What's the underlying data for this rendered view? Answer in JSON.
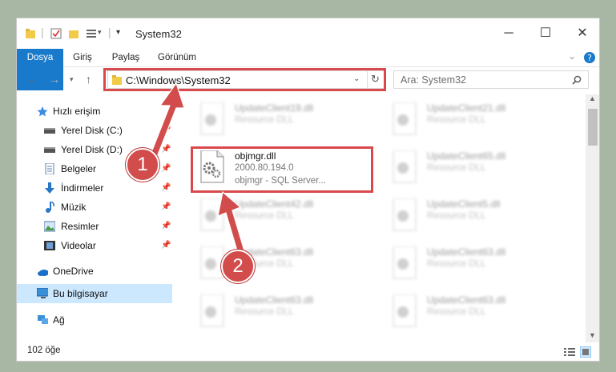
{
  "window": {
    "title": "System32",
    "controls": {
      "minimize": "─",
      "maximize": "☐",
      "close": "✕"
    }
  },
  "ribbon": {
    "tabs": [
      "Dosya",
      "Giriş",
      "Paylaş",
      "Görünüm"
    ],
    "accent": "#1979ca"
  },
  "address": {
    "path": "C:\\Windows\\System32",
    "search_placeholder": "Ara: System32"
  },
  "sidebar": {
    "items": [
      {
        "label": "Hızlı erişim",
        "icon": "star-icon",
        "pinned": false
      },
      {
        "label": "Yerel Disk (C:)",
        "icon": "drive-icon",
        "pinned": true
      },
      {
        "label": "Yerel Disk (D:)",
        "icon": "drive-icon",
        "pinned": true
      },
      {
        "label": "Belgeler",
        "icon": "documents-icon",
        "pinned": true
      },
      {
        "label": "İndirmeler",
        "icon": "download-icon",
        "pinned": true
      },
      {
        "label": "Müzik",
        "icon": "music-icon",
        "pinned": true
      },
      {
        "label": "Resimler",
        "icon": "pictures-icon",
        "pinned": true
      },
      {
        "label": "Videolar",
        "icon": "videos-icon",
        "pinned": true
      },
      {
        "label": "OneDrive",
        "icon": "cloud-icon",
        "pinned": false
      },
      {
        "label": "Bu bilgisayar",
        "icon": "computer-icon",
        "pinned": false
      },
      {
        "label": "Ağ",
        "icon": "network-icon",
        "pinned": false
      }
    ]
  },
  "files": {
    "highlighted": {
      "name": "objmgr.dll",
      "version": "2000.80.194.0",
      "description": "objmgr - SQL Server..."
    },
    "left_column": [
      {
        "name": "UpdateClient19.dll",
        "type": "Resource DLL"
      },
      {
        "name": "UpdateClient42.dll",
        "type": "Resource DLL"
      },
      {
        "name": "UpdateClient63.dll",
        "type": "Resource DLL"
      },
      {
        "name": "UpdateClient63.dll",
        "type": "Resource DLL"
      }
    ],
    "right_column": [
      {
        "name": "UpdateClient21.dll",
        "type": "Resource DLL"
      },
      {
        "name": "UpdateClient65.dll",
        "type": "Resource DLL"
      },
      {
        "name": "UpdateClient5.dll",
        "type": "Resource DLL"
      },
      {
        "name": "UpdateClient63.dll",
        "type": "Resource DLL"
      },
      {
        "name": "UpdateClient63.dll",
        "type": "Resource DLL"
      }
    ]
  },
  "status": {
    "count": "102 öğe"
  },
  "annotations": {
    "step1": "1",
    "step2": "2",
    "color": "#d14c4b"
  }
}
